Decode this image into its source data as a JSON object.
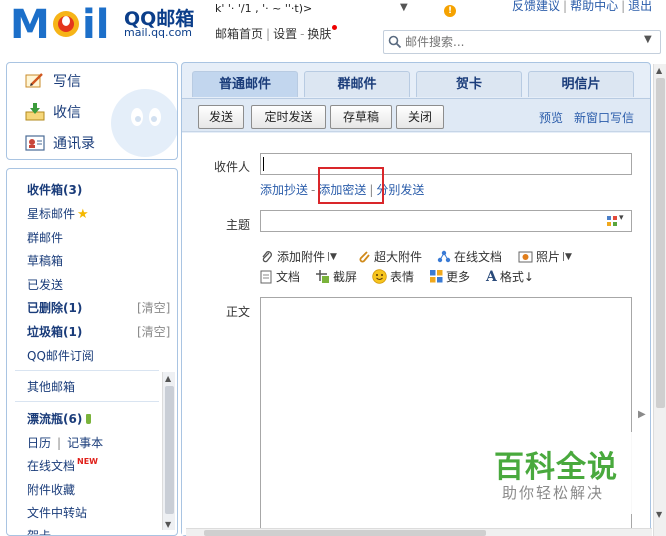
{
  "header": {
    "logo_title": "QQ邮箱",
    "logo_domain": "mail.qq.com",
    "account_line": "k' '· '/1 , '· ~ ''·t)>",
    "nav_home": "邮箱首页",
    "nav_settings": "设置",
    "nav_skin": "换肤",
    "top_link_feedback": "反馈建议",
    "top_link_help": "帮助中心",
    "top_link_logout": "退出",
    "search_placeholder": "邮件搜索..."
  },
  "sidebar": {
    "quick_actions": [
      {
        "label": "写信",
        "icon": "compose-pen-icon"
      },
      {
        "label": "收信",
        "icon": "inbox-download-icon"
      },
      {
        "label": "通讯录",
        "icon": "contacts-card-icon"
      }
    ],
    "folders": {
      "inbox": "收件箱(3)",
      "starred": "星标邮件",
      "group": "群邮件",
      "drafts": "草稿箱",
      "sent": "已发送",
      "deleted": "已删除(1)",
      "spam": "垃圾箱(1)",
      "subscribe": "QQ邮件订阅",
      "other_mailbox": "其他邮箱",
      "bottle": "漂流瓶(6)",
      "calendar": "日历",
      "notes": "记事本",
      "online_docs": "在线文档",
      "online_docs_badge": "NEW",
      "attachments": "附件收藏",
      "file_transfer": "文件中转站",
      "cards": "贺卡"
    },
    "clear_label": "[清空]"
  },
  "compose": {
    "tabs": [
      "普通邮件",
      "群邮件",
      "贺卡",
      "明信片"
    ],
    "buttons": {
      "send": "发送",
      "scheduled": "定时发送",
      "save_draft": "存草稿",
      "close": "关闭"
    },
    "preview": "预览",
    "new_window": "新窗口写信",
    "to_label": "收件人",
    "add_cc": "添加抄送",
    "add_bcc": "添加密送",
    "separate_send": "分别发送",
    "subject_label": "主题",
    "body_label": "正文",
    "tools_row1": [
      {
        "label": "添加附件",
        "icon": "paperclip-icon",
        "dropdown": true
      },
      {
        "label": "超大附件",
        "icon": "large-attachment-icon",
        "dropdown": false
      },
      {
        "label": "在线文档",
        "icon": "online-doc-icon",
        "dropdown": false
      },
      {
        "label": "照片",
        "icon": "photo-icon",
        "dropdown": true
      }
    ],
    "tools_row2": [
      {
        "label": "文档",
        "icon": "document-icon"
      },
      {
        "label": "截屏",
        "icon": "screenshot-icon"
      },
      {
        "label": "表情",
        "icon": "emoji-icon"
      },
      {
        "label": "更多",
        "icon": "more-grid-icon"
      },
      {
        "label": "格式↓",
        "icon": "font-format-icon"
      }
    ]
  },
  "watermark": {
    "title": "百科全说",
    "subtitle": "助你轻松解决"
  },
  "colors": {
    "brand_blue": "#1c6fc9",
    "panel_border": "#a9c4e2",
    "highlight_red": "#d9262a",
    "watermark_green": "#49a93d"
  }
}
